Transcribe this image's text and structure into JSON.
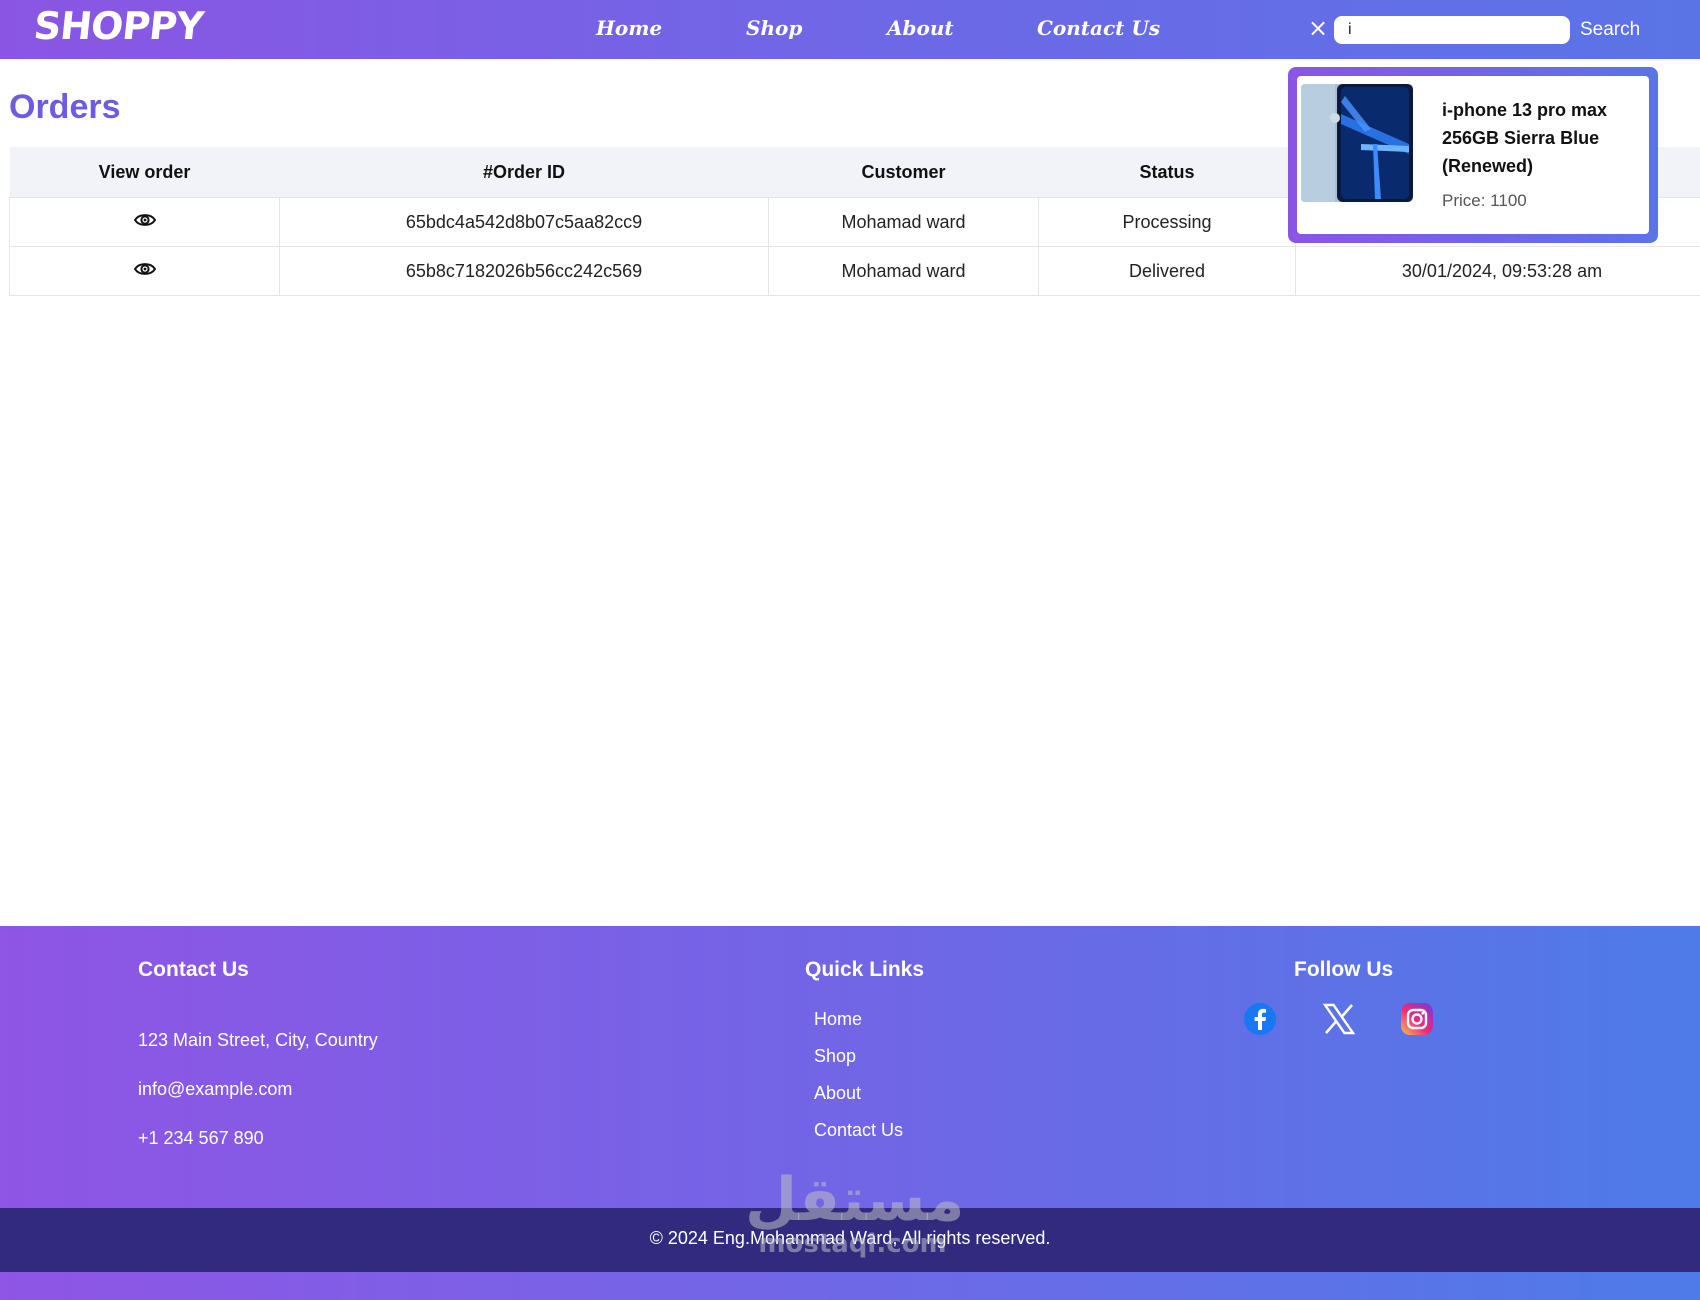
{
  "brand": {
    "logo_text": "SHOPPY"
  },
  "nav": {
    "links": [
      {
        "label": "Home"
      },
      {
        "label": "Shop"
      },
      {
        "label": "About"
      },
      {
        "label": "Contact Us"
      }
    ],
    "clear_label": "×",
    "search_value": "i",
    "search_button": "Search"
  },
  "page": {
    "title": "Orders"
  },
  "orders_table": {
    "columns": [
      "View order",
      "#Order ID",
      "Customer",
      "Status"
    ],
    "rows": [
      {
        "order_id": "65bdc4a542d8b07c5aa82cc9",
        "customer": "Mohamad ward",
        "status": "Processing",
        "date": ""
      },
      {
        "order_id": "65b8c7182026b56cc242c569",
        "customer": "Mohamad ward",
        "status": "Delivered",
        "date": "30/01/2024, 09:53:28 am"
      }
    ]
  },
  "search_popup": {
    "product_name": "i-phone 13 pro max 256GB Sierra Blue (Renewed)",
    "price_text": "Price: 1100"
  },
  "footer": {
    "contact": {
      "heading": "Contact Us",
      "address": "123 Main Street, City, Country",
      "email": "info@example.com",
      "phone": "+1 234 567 890"
    },
    "quick_links": {
      "heading": "Quick Links",
      "items": [
        "Home",
        "Shop",
        "About",
        "Contact Us"
      ]
    },
    "follow": {
      "heading": "Follow Us",
      "icons": [
        "facebook-icon",
        "x-icon",
        "instagram-icon"
      ]
    },
    "copyright": "© 2024 Eng.Mohammad Ward, All rights reserved."
  },
  "watermark": {
    "arabic": "مستقل",
    "latin": "mostaql.com"
  },
  "colors": {
    "brand_purple": "#8b55e4",
    "brand_blue": "#5a74e6",
    "title": "#6c5ce0",
    "processing": "#3d6fb4",
    "delivered": "#2f9e44",
    "copyright_bar": "#312a7e"
  }
}
